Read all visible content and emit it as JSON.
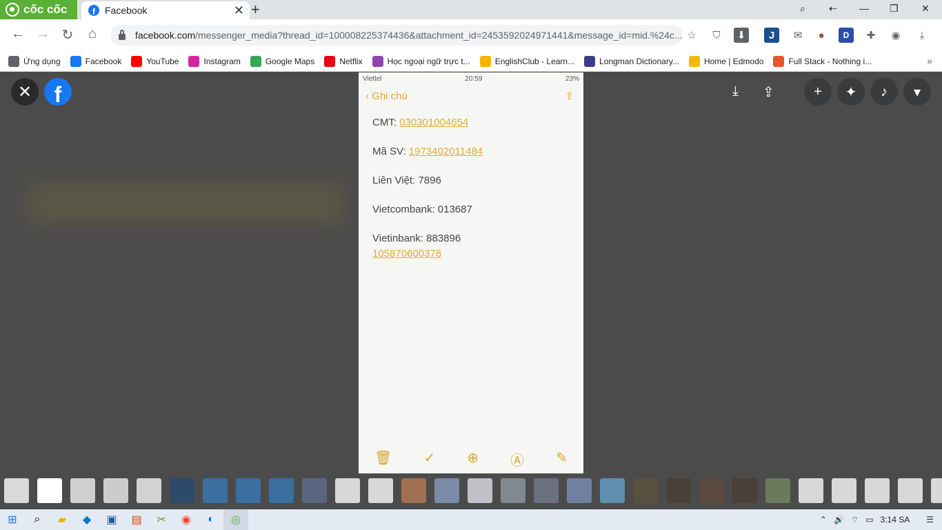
{
  "browser": {
    "brand_label": "cốc cốc",
    "tab": {
      "title": "Facebook"
    },
    "url": {
      "host": "facebook.com",
      "rest": "/messenger_media?thread_id=100008225374436&attachment_id=2453592024971441&message_id=mid.%24c..."
    },
    "bookmarks": [
      {
        "label": "Ứng dụng",
        "icon": "apps-grid-icon",
        "color": "#5f6368"
      },
      {
        "label": "Facebook",
        "icon": "facebook-icon",
        "color": "#1877f2"
      },
      {
        "label": "YouTube",
        "icon": "youtube-icon",
        "color": "#ff0000"
      },
      {
        "label": "Instagram",
        "icon": "instagram-icon",
        "color": "#d6249f"
      },
      {
        "label": "Google Maps",
        "icon": "google-maps-icon",
        "color": "#34a853"
      },
      {
        "label": "Netflix",
        "icon": "netflix-icon",
        "color": "#e50914"
      },
      {
        "label": "Học ngoại ngữ trực t...",
        "icon": "language-icon",
        "color": "#8e44ad"
      },
      {
        "label": "EnglishClub - Learn...",
        "icon": "englishclub-icon",
        "color": "#f4b400"
      },
      {
        "label": "Longman Dictionary...",
        "icon": "longman-icon",
        "color": "#3c3c8c"
      },
      {
        "label": "Home | Edmodo",
        "icon": "edmodo-icon",
        "color": "#f6b900"
      },
      {
        "label": "Full Stack - Nothing i...",
        "icon": "fullstack-icon",
        "color": "#e8542e"
      }
    ]
  },
  "viewer": {
    "note": {
      "status": {
        "carrier": "Viettel",
        "time": "20:59",
        "battery": "23%"
      },
      "back_label": "Ghi chú",
      "lines": [
        {
          "label": "CMT: ",
          "value": "030301004654",
          "link": true
        },
        {
          "label": "Mã SV: ",
          "value": "1973402011484",
          "link": true
        },
        {
          "label": "Liên Việt: ",
          "value": "7896",
          "link": false
        },
        {
          "label": "Vietcombank: ",
          "value": "013687",
          "link": false
        },
        {
          "label": "Vietinbank: ",
          "value": "883896",
          "link": false,
          "extra": "105870600378"
        }
      ]
    },
    "thumbnail_colors": [
      "#d9d9d9",
      "#ffffff",
      "#cfcfcf",
      "#cccccc",
      "#d2d2d2",
      "#2d4a6a",
      "#3a6fa0",
      "#3a6fa0",
      "#3a6fa0",
      "#5a6680",
      "#d8d8d8",
      "#d8d8d8",
      "#a07050",
      "#7a8aa8",
      "#c0c0c8",
      "#808890",
      "#6a7080",
      "#7080a0",
      "#6090b0",
      "#5a5040",
      "#4a4038",
      "#5a4a40",
      "#4a4038",
      "#6a7a5a",
      "#d8d8d8",
      "#d8d8d8",
      "#d8d8d8",
      "#d8d8d8",
      "#d8d8d8"
    ]
  },
  "taskbar": {
    "time": "3:14 SA"
  }
}
